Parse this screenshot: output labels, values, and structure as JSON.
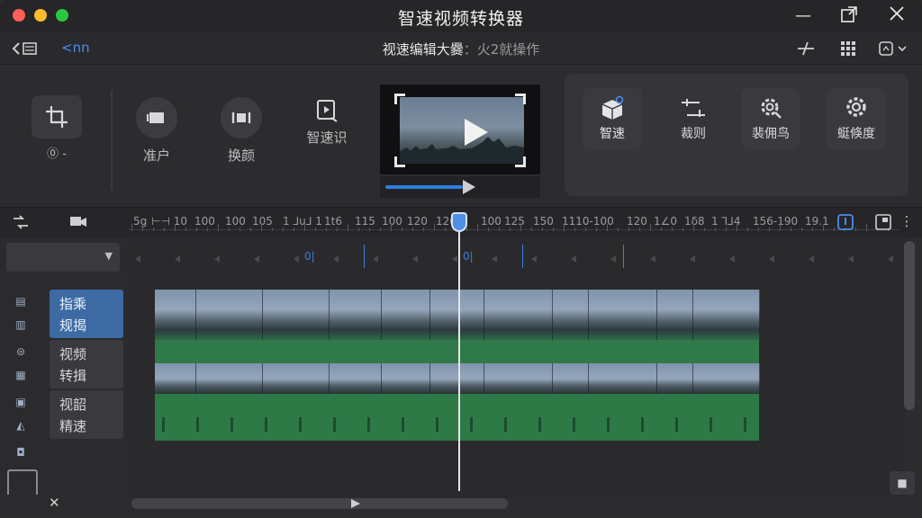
{
  "window": {
    "title": "智速视频转换器",
    "controls": [
      "minimize-icon",
      "maximize-icon",
      "close-icon"
    ]
  },
  "subbar": {
    "nav_link": "<nn",
    "doc_title": "视速编辑大爨",
    "doc_subtitle": "火2就操作",
    "separator": "："
  },
  "tools": {
    "crop_label": "⓪ -",
    "items": [
      {
        "label": "准户",
        "icon": "camera-icon"
      },
      {
        "label": "换颜",
        "icon": "swap-icon"
      },
      {
        "label": "智速识",
        "icon": "smart-recognize-icon"
      }
    ],
    "panel_items": [
      {
        "label": "智速",
        "icon": "box-icon"
      },
      {
        "label": "裁则",
        "icon": "trim-icon"
      },
      {
        "label": "裴佣鸟",
        "icon": "gear-search-icon"
      },
      {
        "label": "蜓倏度",
        "icon": "gear-icon"
      }
    ],
    "preview_progress": 0.52
  },
  "timeline": {
    "ruler_labels": [
      "5g",
      "⊢⊣ 10",
      "100",
      "100",
      "105",
      "1 ⅃u⅃ 1",
      "1t6",
      "115",
      "100",
      "120",
      "120",
      "0",
      "100",
      "125",
      "150",
      "1110-100",
      "120",
      "1∠0",
      "1δ8",
      "1 ⅂⅃4",
      "156-190",
      "19.1"
    ],
    "sub_marks": [
      "0|",
      "0|"
    ],
    "accent": "#3d7ee0"
  },
  "tracks": {
    "labels": [
      {
        "line1": "指乘",
        "line2": "规揭",
        "active": true
      },
      {
        "line1": "视频",
        "line2": "转揖",
        "active": false
      },
      {
        "line1": "视韶",
        "line2": "精速",
        "active": false
      }
    ]
  }
}
